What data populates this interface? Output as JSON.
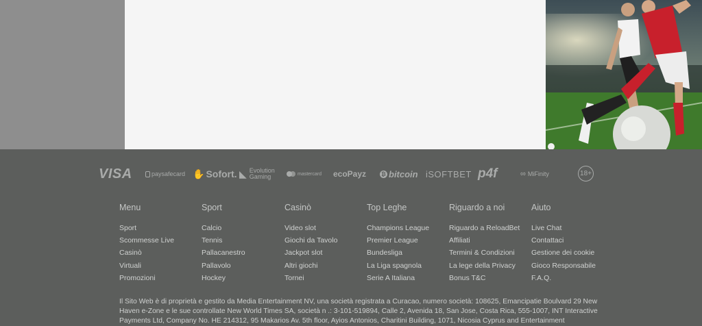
{
  "payments": {
    "visa": "VISA",
    "paysafecard": "paysafecard",
    "sofort": "Sofort.",
    "evolution_line1": "Evolution",
    "evolution_line2": "Gaming",
    "mastercard": "mastercard",
    "ecopayz": "ecoPayz",
    "bitcoin": "bitcoin",
    "isoftbet": "iSOFTBET",
    "p4f": "p4f",
    "mifinity": "MiFinity",
    "age": "18+"
  },
  "footer": {
    "columns": [
      {
        "title": "Menu",
        "links": [
          "Sport",
          "Scommesse Live",
          "Casinò",
          "Virtuali",
          "Promozioni"
        ]
      },
      {
        "title": "Sport",
        "links": [
          "Calcio",
          "Tennis",
          "Pallacanestro",
          "Pallavolo",
          "Hockey"
        ]
      },
      {
        "title": "Casinò",
        "links": [
          "Video slot",
          "Giochi da Tavolo",
          "Jackpot slot",
          "Altri giochi",
          "Tornei"
        ]
      },
      {
        "title": "Top Leghe",
        "links": [
          "Champions League",
          "Premier League",
          "Bundesliga",
          "La Liga spagnola",
          "Serie A Italiana"
        ]
      },
      {
        "title": "Riguardo a noi",
        "links": [
          "Riguardo a ReloadBet",
          "Affiliati",
          "Termini & Condizioni",
          "La lege della Privacy",
          "Bonus T&C"
        ]
      },
      {
        "title": "Aiuto",
        "links": [
          "Live Chat",
          "Contattaci",
          "Gestione dei cookie",
          "Gioco Responsabile",
          "F.A.Q."
        ]
      }
    ],
    "legal": "Il Sito Web è di proprietà e gestito da Media Entertainment NV, una società registrata a Curacao, numero società: 108625, Emancipatie Boulvard 29 New Haven e-Zone e le sue controllate New World Times SA, società n .: 3-101-519894, Calle 2, Avenida 18, San Jose, Costa Rica, 555-1007, INT Interactive Payments Ltd, Company No. HE 214312, 95 Makarios Av. 5th floor, Ayios Antonios, Charitini Building, 1071, Nicosia Cyprus and Entertainment"
  }
}
